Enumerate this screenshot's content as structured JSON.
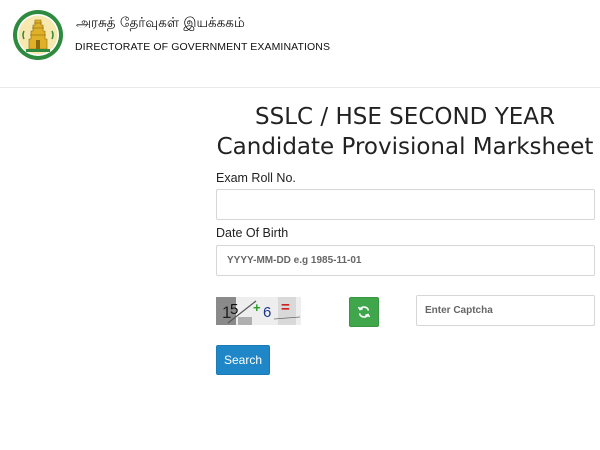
{
  "header": {
    "org_name_tamil": "அரசுத் தேர்வுகள் இயக்ககம்",
    "org_name_english": "DIRECTORATE OF GOVERNMENT EXAMINATIONS",
    "logo_icon": "tamil-nadu-emblem-icon"
  },
  "main": {
    "title_line1": "SSLC / HSE SECOND YEAR",
    "title_line2": "Candidate Provisional Marksheet"
  },
  "form": {
    "roll_label": "Exam Roll No.",
    "roll_value": "",
    "roll_placeholder": "",
    "dob_label": "Date Of Birth",
    "dob_value": "",
    "dob_placeholder": "YYYY-MM-DD e.g 1985-11-01",
    "captcha": {
      "image_text": "15 + 6 =",
      "refresh_icon": "refresh-icon",
      "input_value": "",
      "input_placeholder": "Enter Captcha"
    },
    "search_label": "Search"
  },
  "colors": {
    "refresh_button": "#3fa64c",
    "search_button": "#1f87c8",
    "emblem_green": "#2d8a3e",
    "emblem_gold": "#e0b028"
  }
}
